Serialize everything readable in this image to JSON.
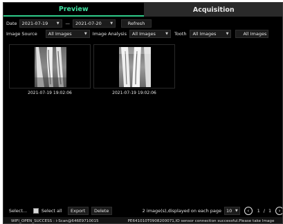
{
  "tabs": [
    {
      "label": "Preview",
      "active": true
    },
    {
      "label": "Acquisition",
      "active": false
    }
  ],
  "filters": {
    "date_label": "Date",
    "date_from": "2021-07-19",
    "date_sep": "—",
    "date_to": "2021-07-20",
    "refresh_label": "Refresh",
    "image_source_label": "Image Source",
    "image_source_value": "All Images",
    "image_analysis_label": "Image Analysis",
    "image_analysis_value": "All Images",
    "tooth_label": "Tooth",
    "tooth_value": "All Images",
    "extra_value": "All Images"
  },
  "images": [
    {
      "timestamp": "2021-07-19 19:02:06"
    },
    {
      "timestamp": "2021-07-19 19:02:06"
    }
  ],
  "toolbar": {
    "select_label": "Select...",
    "select_all_label": "Select all",
    "export_label": "Export",
    "delete_label": "Delete",
    "page_info": "2 image(s),displayed on each page",
    "page_size": "10",
    "current_page": "1",
    "page_sep": "/",
    "total_pages": "1"
  },
  "status": {
    "left": "WIFI_OPEN_SUCCESS : i-Scan@646E9710015",
    "right": "PE641010T0908200071,IO sensor connection successful.Please take Image"
  },
  "colors": {
    "accent": "#2ecc8a",
    "background": "#000000",
    "control": "#1c1c1c"
  },
  "icons": {
    "dropdown": "chevron-down-icon",
    "prev": "chevron-left-icon",
    "next": "chevron-right-icon"
  }
}
